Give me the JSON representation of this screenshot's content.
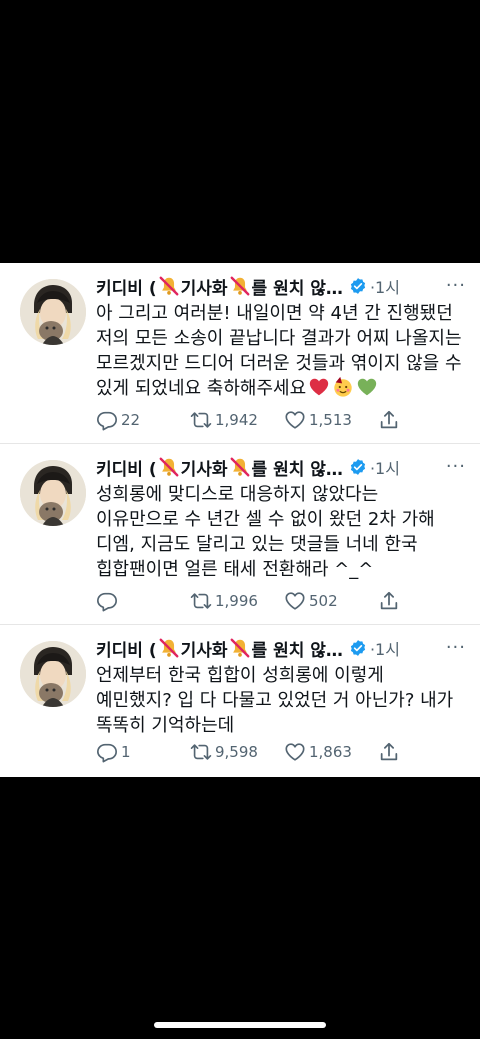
{
  "tweets": [
    {
      "name_prefix": "키디비 (",
      "name_mid": "기사화",
      "name_suffix": "를 원치 않…",
      "time": "1시",
      "more": "···",
      "text": "아 그리고 여러분! 내일이면 약 4년 간 진행됐던 저의 모든 소송이 끝납니다 결과가 어찌 나올지는 모르겠지만 드디어 더러운 것들과 엮이지 않을 수 있게 되었네요 축하해주세요",
      "emojis": [
        "red-heart",
        "partying-face",
        "green-heart"
      ],
      "replies": "22",
      "retweets": "1,942",
      "likes": "1,513"
    },
    {
      "name_prefix": "키디비 (",
      "name_mid": "기사화",
      "name_suffix": "를 원치 않…",
      "time": "1시",
      "more": "···",
      "text": "성희롱에 맞디스로 대응하지 않았다는 이유만으로 수 년간 셀 수 없이 왔던 2차 가해 디엠, 지금도 달리고 있는 댓글들 너네 한국 힙합팬이면 얼른 태세 전환해라 ^_^",
      "replies": "",
      "retweets": "1,996",
      "likes": "502"
    },
    {
      "name_prefix": "키디비 (",
      "name_mid": "기사화",
      "name_suffix": "를 원치 않…",
      "time": "1시",
      "more": "···",
      "text": "언제부터 한국 힙합이 성희롱에 이렇게 예민했지? 입 다 다물고 있었던 거 아닌가? 내가 똑똑히 기억하는데",
      "replies": "1",
      "retweets": "9,598",
      "likes": "1,863"
    }
  ],
  "icons": {
    "muted_bell": "no-bell-icon",
    "verified": "verified-badge-icon",
    "reply": "reply-icon",
    "retweet": "retweet-icon",
    "like": "like-icon",
    "share": "share-icon"
  },
  "colors": {
    "verified": "#1d9bf0",
    "text_secondary": "#536471",
    "background": "#000000",
    "card": "#ffffff"
  }
}
